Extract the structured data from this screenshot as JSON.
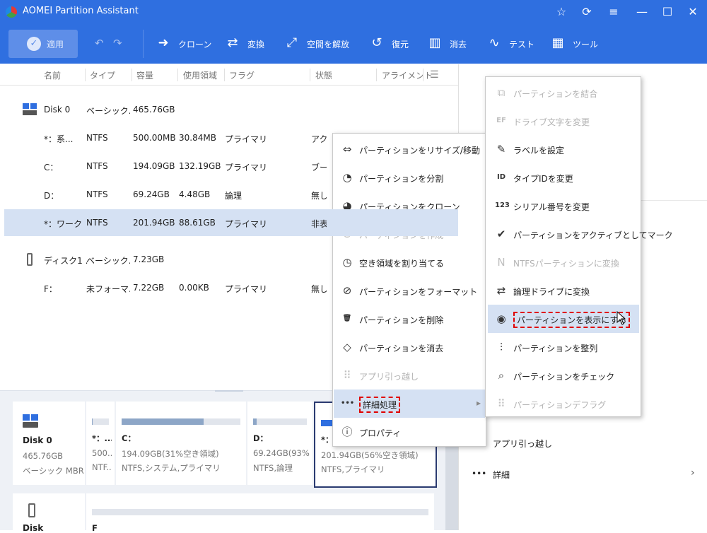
{
  "window": {
    "title": "AOMEI Partition Assistant",
    "controls": [
      "☆",
      "⟳",
      "≡",
      "—",
      "☐",
      "✕"
    ]
  },
  "toolbar": {
    "apply_label": "適用",
    "tools": [
      {
        "label": "クローン",
        "icon": "clone-icon",
        "glyph": "➜"
      },
      {
        "label": "変換",
        "icon": "convert-icon",
        "glyph": "⇄"
      },
      {
        "label": "空間を解放",
        "icon": "free-space-icon",
        "glyph": "⤢"
      },
      {
        "label": "復元",
        "icon": "restore-icon",
        "glyph": "↺"
      },
      {
        "label": "消去",
        "icon": "wipe-icon",
        "glyph": "▥"
      },
      {
        "label": "テスト",
        "icon": "test-icon",
        "glyph": "∿"
      },
      {
        "label": "ツール",
        "icon": "tools-icon",
        "glyph": "▦"
      }
    ]
  },
  "table": {
    "headers": [
      "名前",
      "タイプ",
      "容量",
      "使用領域",
      "フラグ",
      "状態",
      "アライメント"
    ],
    "rows": [
      {
        "name": "Disk 0",
        "type": "ベーシック...",
        "cap": "465.76GB",
        "used": "",
        "flag": "",
        "state": ""
      },
      {
        "name": "*：系...",
        "type": "NTFS",
        "cap": "500.00MB",
        "used": "30.84MB",
        "flag": "プライマリ",
        "state": "アクテ"
      },
      {
        "name": "C：",
        "type": "NTFS",
        "cap": "194.09GB",
        "used": "132.19GB",
        "flag": "プライマリ",
        "state": "ブート"
      },
      {
        "name": "D：",
        "type": "NTFS",
        "cap": "69.24GB",
        "used": "4.48GB",
        "flag": "論理",
        "state": "無し"
      },
      {
        "name": "*：ワーク",
        "type": "NTFS",
        "cap": "201.94GB",
        "used": "88.61GB",
        "flag": "プライマリ",
        "state": "非表"
      },
      {
        "name": "ディスク1 ...",
        "type": "ベーシック...",
        "cap": "7.23GB",
        "used": "",
        "flag": "",
        "state": ""
      },
      {
        "name": "F：",
        "type": "未フォーマ...",
        "cap": "7.22GB",
        "used": "0.00KB",
        "flag": "プライマリ",
        "state": "無し"
      }
    ]
  },
  "diskmap": {
    "disk0": {
      "name": "Disk 0",
      "size": "465.76GB",
      "type": "ベーシック MBR"
    },
    "parts": [
      {
        "l1": "*：...",
        "l2": "500...",
        "l3": "NTF...",
        "fill": 0.06
      },
      {
        "l1": "C：",
        "l2": "194.09GB(31%空き領域)",
        "l3": "NTFS,システム,プライマリ",
        "fill": 0.69
      },
      {
        "l1": "D：",
        "l2": "69.24GB(93%...",
        "l3": "NTFS,論理",
        "fill": 0.07
      },
      {
        "l1": "*：*",
        "l2": "201.94GB(56%空き領域)",
        "l3": "NTFS,プライマリ",
        "fill": 0.44
      }
    ],
    "disk1_label": "Disk",
    "disk1_part": "F"
  },
  "rightpane": {
    "app_move": "アプリ引っ越し",
    "details": "詳細"
  },
  "context_menu": [
    {
      "label": "パーティションをリサイズ/移動",
      "icon": "resize-icon",
      "glyph": "⇔",
      "disabled": false
    },
    {
      "label": "パーティションを分割",
      "icon": "split-icon",
      "glyph": "◔",
      "disabled": false
    },
    {
      "label": "パーティションをクローン",
      "icon": "clone-partition-icon",
      "glyph": "◕",
      "disabled": false
    },
    {
      "label": "パーティションを作成",
      "icon": "create-icon",
      "glyph": "⊕",
      "disabled": true
    },
    {
      "label": "空き領域を割り当てる",
      "icon": "allocate-icon",
      "glyph": "◷",
      "disabled": false
    },
    {
      "label": "パーティションをフォーマット",
      "icon": "format-icon",
      "glyph": "⊘",
      "disabled": false
    },
    {
      "label": "パーティションを削除",
      "icon": "delete-icon",
      "glyph": "🗑",
      "disabled": false
    },
    {
      "label": "パーティションを消去",
      "icon": "erase-icon",
      "glyph": "◇",
      "disabled": false
    },
    {
      "label": "アプリ引っ越し",
      "icon": "app-move-icon",
      "glyph": "⠿",
      "disabled": true
    },
    {
      "label": "詳細処理",
      "icon": "more-icon",
      "glyph": "•••",
      "disabled": false,
      "highlighted": true
    },
    {
      "label": "プロパティ",
      "icon": "info-icon",
      "glyph": "ⓘ",
      "disabled": false
    }
  ],
  "submenu": [
    {
      "label": "パーティションを結合",
      "icon": "merge-icon",
      "glyph": "⧉",
      "disabled": true
    },
    {
      "label": "ドライブ文字を変更",
      "icon": "drive-letter-icon",
      "glyph": "EF",
      "disabled": true
    },
    {
      "label": "ラベルを設定",
      "icon": "pencil-icon",
      "glyph": "✎",
      "disabled": false
    },
    {
      "label": "タイプIDを変更",
      "icon": "type-id-icon",
      "glyph": "ID",
      "disabled": false
    },
    {
      "label": "シリアル番号を変更",
      "icon": "serial-icon",
      "glyph": "123",
      "disabled": false
    },
    {
      "label": "パーティションをアクティブとしてマーク",
      "icon": "active-icon",
      "glyph": "✔",
      "disabled": false
    },
    {
      "label": "NTFSパーティションに変換",
      "icon": "ntfs-icon",
      "glyph": "N",
      "disabled": true
    },
    {
      "label": "論理ドライブに変換",
      "icon": "logical-icon",
      "glyph": "⇄",
      "disabled": false
    },
    {
      "label": "パーティションを表示にする",
      "icon": "eye-icon",
      "glyph": "◉",
      "disabled": false,
      "highlighted": true
    },
    {
      "label": "パーティションを整列",
      "icon": "align-icon",
      "glyph": "⫶",
      "disabled": false
    },
    {
      "label": "パーティションをチェック",
      "icon": "check-icon",
      "glyph": "⌕",
      "disabled": false
    },
    {
      "label": "パーティションデフラグ",
      "icon": "defrag-icon",
      "glyph": "⠿",
      "disabled": true
    }
  ]
}
